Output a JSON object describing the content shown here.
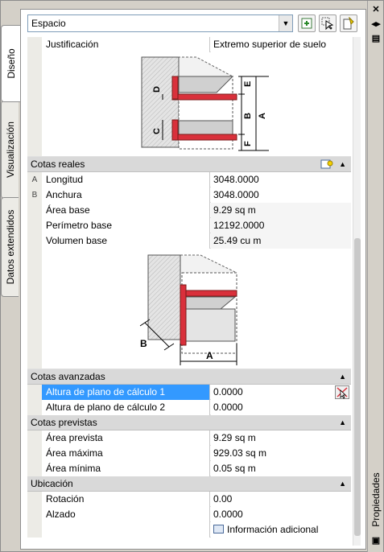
{
  "palette": {
    "title": "Propiedades",
    "tabs": [
      "Diseño",
      "Visualización",
      "Datos extendidos"
    ]
  },
  "toolbar": {
    "object_type": "Espacio"
  },
  "rows_top": [
    {
      "name": "Justificación",
      "value": "Extremo superior de suelo"
    }
  ],
  "diagram1": {
    "labels": [
      "D",
      "E",
      "B",
      "A",
      "C",
      "F"
    ]
  },
  "sections": {
    "cotas_reales": {
      "title": "Cotas reales",
      "rows": [
        {
          "gutter": "A",
          "name": "Longitud",
          "value": "3048.0000"
        },
        {
          "gutter": "B",
          "name": "Anchura",
          "value": "3048.0000"
        },
        {
          "gutter": "",
          "name": "Área base",
          "value": "9.29 sq m"
        },
        {
          "gutter": "",
          "name": "Perímetro base",
          "value": "12192.0000"
        },
        {
          "gutter": "",
          "name": "Volumen base",
          "value": "25.49  cu m"
        }
      ]
    },
    "cotas_avanzadas": {
      "title": "Cotas avanzadas",
      "rows": [
        {
          "name": "Altura de plano de cálculo 1",
          "value": "0.0000"
        },
        {
          "name": "Altura de plano de cálculo 2",
          "value": "0.0000"
        }
      ]
    },
    "cotas_previstas": {
      "title": "Cotas previstas",
      "rows": [
        {
          "name": "Área prevista",
          "value": "9.29 sq m"
        },
        {
          "name": "Área máxima",
          "value": "929.03 sq m"
        },
        {
          "name": "Área mínima",
          "value": "0.05 sq m"
        }
      ]
    },
    "ubicacion": {
      "title": "Ubicación",
      "rows": [
        {
          "name": "Rotación",
          "value": "0.00"
        },
        {
          "name": "Alzado",
          "value": "0.0000"
        },
        {
          "name": "",
          "value": "Información adicional"
        }
      ]
    }
  },
  "diagram2": {
    "labels": [
      "B",
      "A"
    ]
  },
  "colors": {
    "selection": "#3399ff",
    "accent_red": "#d9303b"
  }
}
